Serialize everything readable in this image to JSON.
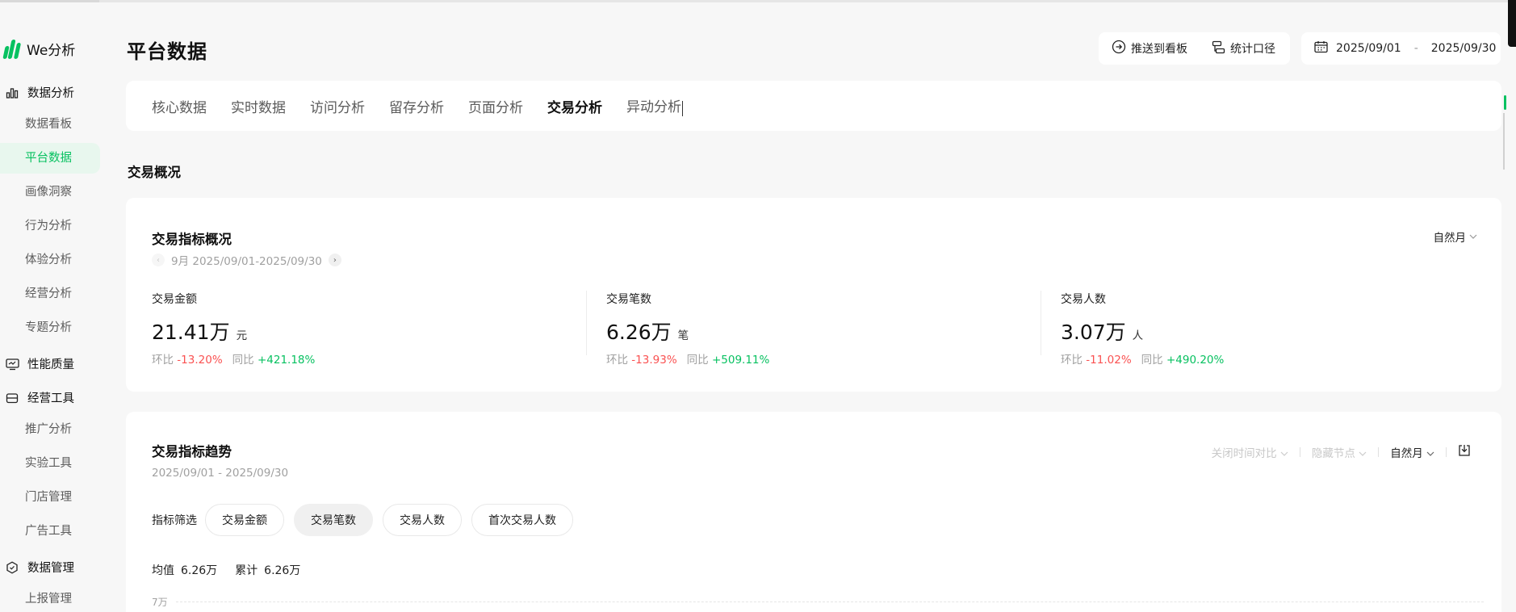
{
  "app": {
    "logo_text": "We分析"
  },
  "sidebar": {
    "groups": [
      {
        "label": "数据分析",
        "icon": "bar-chart-icon"
      },
      {
        "label": "性能质量",
        "icon": "monitor-icon"
      },
      {
        "label": "经营工具",
        "icon": "store-icon"
      },
      {
        "label": "数据管理",
        "icon": "hexagon-icon"
      }
    ],
    "items": [
      {
        "label": "数据看板",
        "active": false
      },
      {
        "label": "平台数据",
        "active": true
      },
      {
        "label": "画像洞察",
        "active": false
      },
      {
        "label": "行为分析",
        "active": false
      },
      {
        "label": "体验分析",
        "active": false
      },
      {
        "label": "经营分析",
        "active": false
      },
      {
        "label": "专题分析",
        "active": false
      },
      {
        "label": "推广分析",
        "active": false
      },
      {
        "label": "实验工具",
        "active": false
      },
      {
        "label": "门店管理",
        "active": false
      },
      {
        "label": "广告工具",
        "active": false
      },
      {
        "label": "上报管理",
        "active": false
      }
    ]
  },
  "header": {
    "title": "平台数据",
    "push_label": "推送到看板",
    "caliber_label": "统计口径",
    "date_start": "2025/09/01",
    "date_sep": "-",
    "date_end": "2025/09/30"
  },
  "tabs": [
    {
      "label": "核心数据",
      "active": false
    },
    {
      "label": "实时数据",
      "active": false
    },
    {
      "label": "访问分析",
      "active": false
    },
    {
      "label": "留存分析",
      "active": false
    },
    {
      "label": "页面分析",
      "active": false
    },
    {
      "label": "交易分析",
      "active": true
    },
    {
      "label": "异动分析",
      "active": false
    }
  ],
  "section": {
    "title": "交易概况"
  },
  "overview": {
    "title": "交易指标概况",
    "period": "9月 2025/09/01-2025/09/30",
    "granularity": "自然月",
    "mom_label": "环比",
    "yoy_label": "同比",
    "metrics": [
      {
        "label": "交易金额",
        "value": "21.41万",
        "unit": "元",
        "mom": "-13.20%",
        "yoy": "+421.18%"
      },
      {
        "label": "交易笔数",
        "value": "6.26万",
        "unit": "笔",
        "mom": "-13.93%",
        "yoy": "+509.11%"
      },
      {
        "label": "交易人数",
        "value": "3.07万",
        "unit": "人",
        "mom": "-11.02%",
        "yoy": "+490.20%"
      }
    ]
  },
  "trend": {
    "title": "交易指标趋势",
    "range": "2025/09/01 - 2025/09/30",
    "compare_toggle": "关闭时间对比",
    "hide_nodes": "隐藏节点",
    "granularity": "自然月",
    "filter_label": "指标筛选",
    "chips": [
      {
        "label": "交易金额",
        "active": false
      },
      {
        "label": "交易笔数",
        "active": true
      },
      {
        "label": "交易人数",
        "active": false
      },
      {
        "label": "首次交易人数",
        "active": false
      }
    ],
    "avg_label": "均值",
    "avg_value": "6.26万",
    "sum_label": "累计",
    "sum_value": "6.26万",
    "y_tick_top": "7万"
  },
  "colors": {
    "accent": "#07c160",
    "negative": "#fa5151",
    "positive": "#07c160"
  }
}
